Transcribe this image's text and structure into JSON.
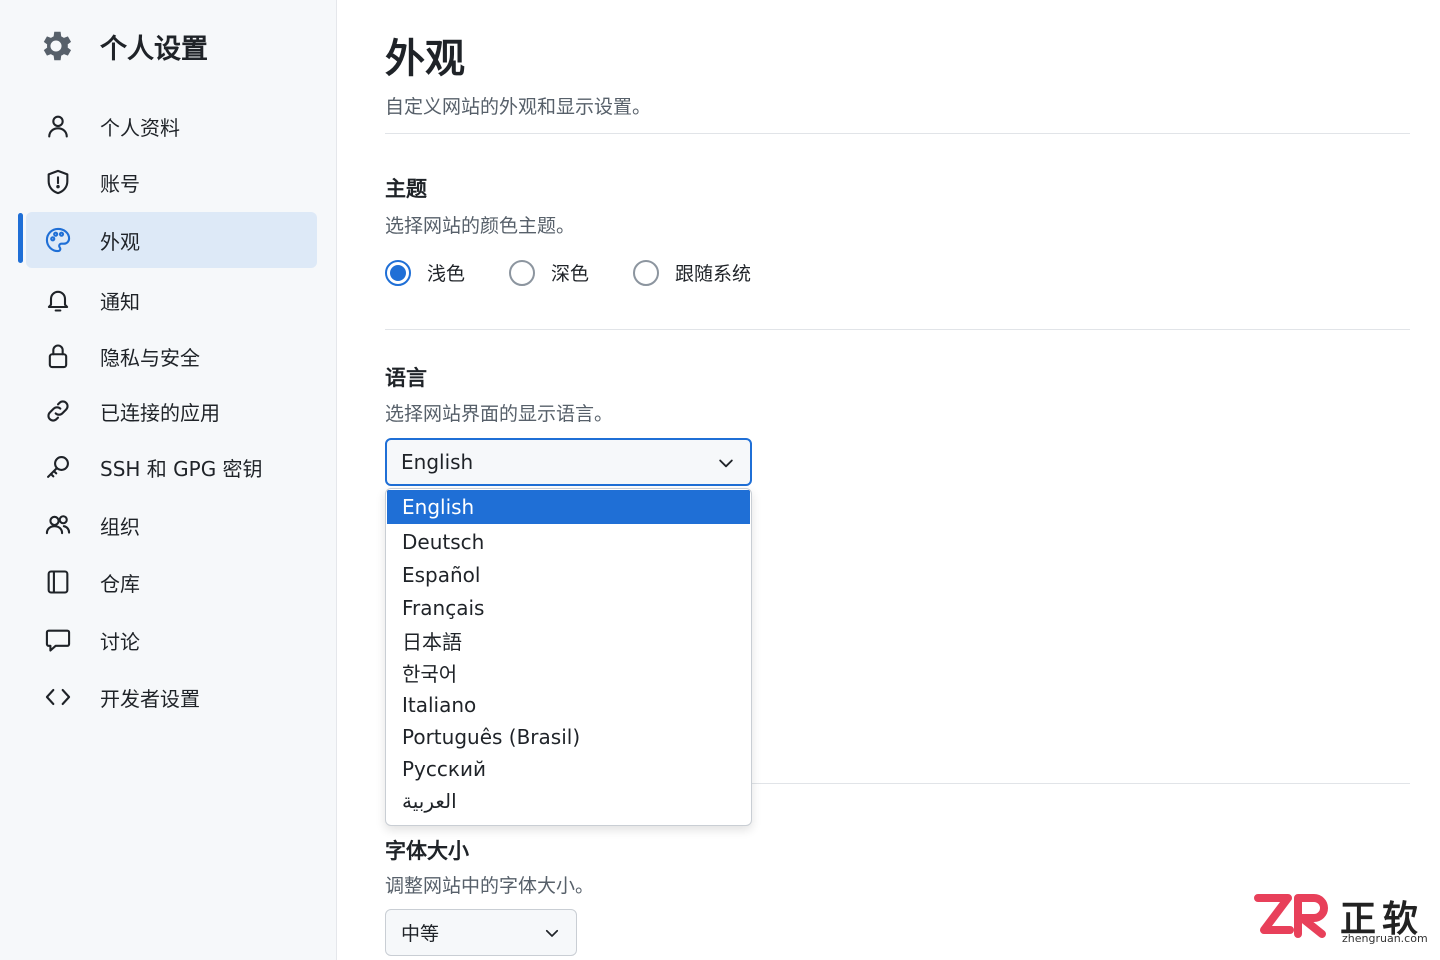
{
  "sidebar": {
    "title": "个人设置",
    "items": [
      {
        "label": "个人资料",
        "icon": "person-icon"
      },
      {
        "label": "账号",
        "icon": "shield-icon"
      },
      {
        "label": "外观",
        "icon": "palette-icon",
        "active": true
      },
      {
        "label": "通知",
        "icon": "bell-icon"
      },
      {
        "label": "隐私与安全",
        "icon": "lock-icon"
      },
      {
        "label": "已连接的应用",
        "icon": "link-icon"
      },
      {
        "label": "SSH 和 GPG 密钥",
        "icon": "key-icon"
      },
      {
        "label": "组织",
        "icon": "people-icon"
      },
      {
        "label": "仓库",
        "icon": "repo-icon"
      },
      {
        "label": "讨论",
        "icon": "comment-icon"
      },
      {
        "label": "开发者设置",
        "icon": "code-icon"
      }
    ]
  },
  "main": {
    "title": "外观",
    "description": "自定义网站的外观和显示设置。",
    "theme": {
      "title": "主题",
      "description": "选择网站的颜色主题。",
      "options": [
        "浅色",
        "深色",
        "跟随系统"
      ],
      "selected": "浅色"
    },
    "language": {
      "title": "语言",
      "description": "选择网站界面的显示语言。",
      "selected": "English",
      "options": [
        "English",
        "Deutsch",
        "Español",
        "Français",
        "日本語",
        "한국어",
        "Italiano",
        "Português (Brasil)",
        "Русский",
        "العربية"
      ]
    },
    "font_size": {
      "title": "字体大小",
      "description": "调整网站中的字体大小。",
      "selected": "中等"
    }
  },
  "watermark": {
    "brand": "正软",
    "url": "zhengruan.com"
  },
  "colors": {
    "accent": "#1f6fd6",
    "sidebar_bg": "#f6f8fa",
    "active_bg": "#dde9f7"
  }
}
